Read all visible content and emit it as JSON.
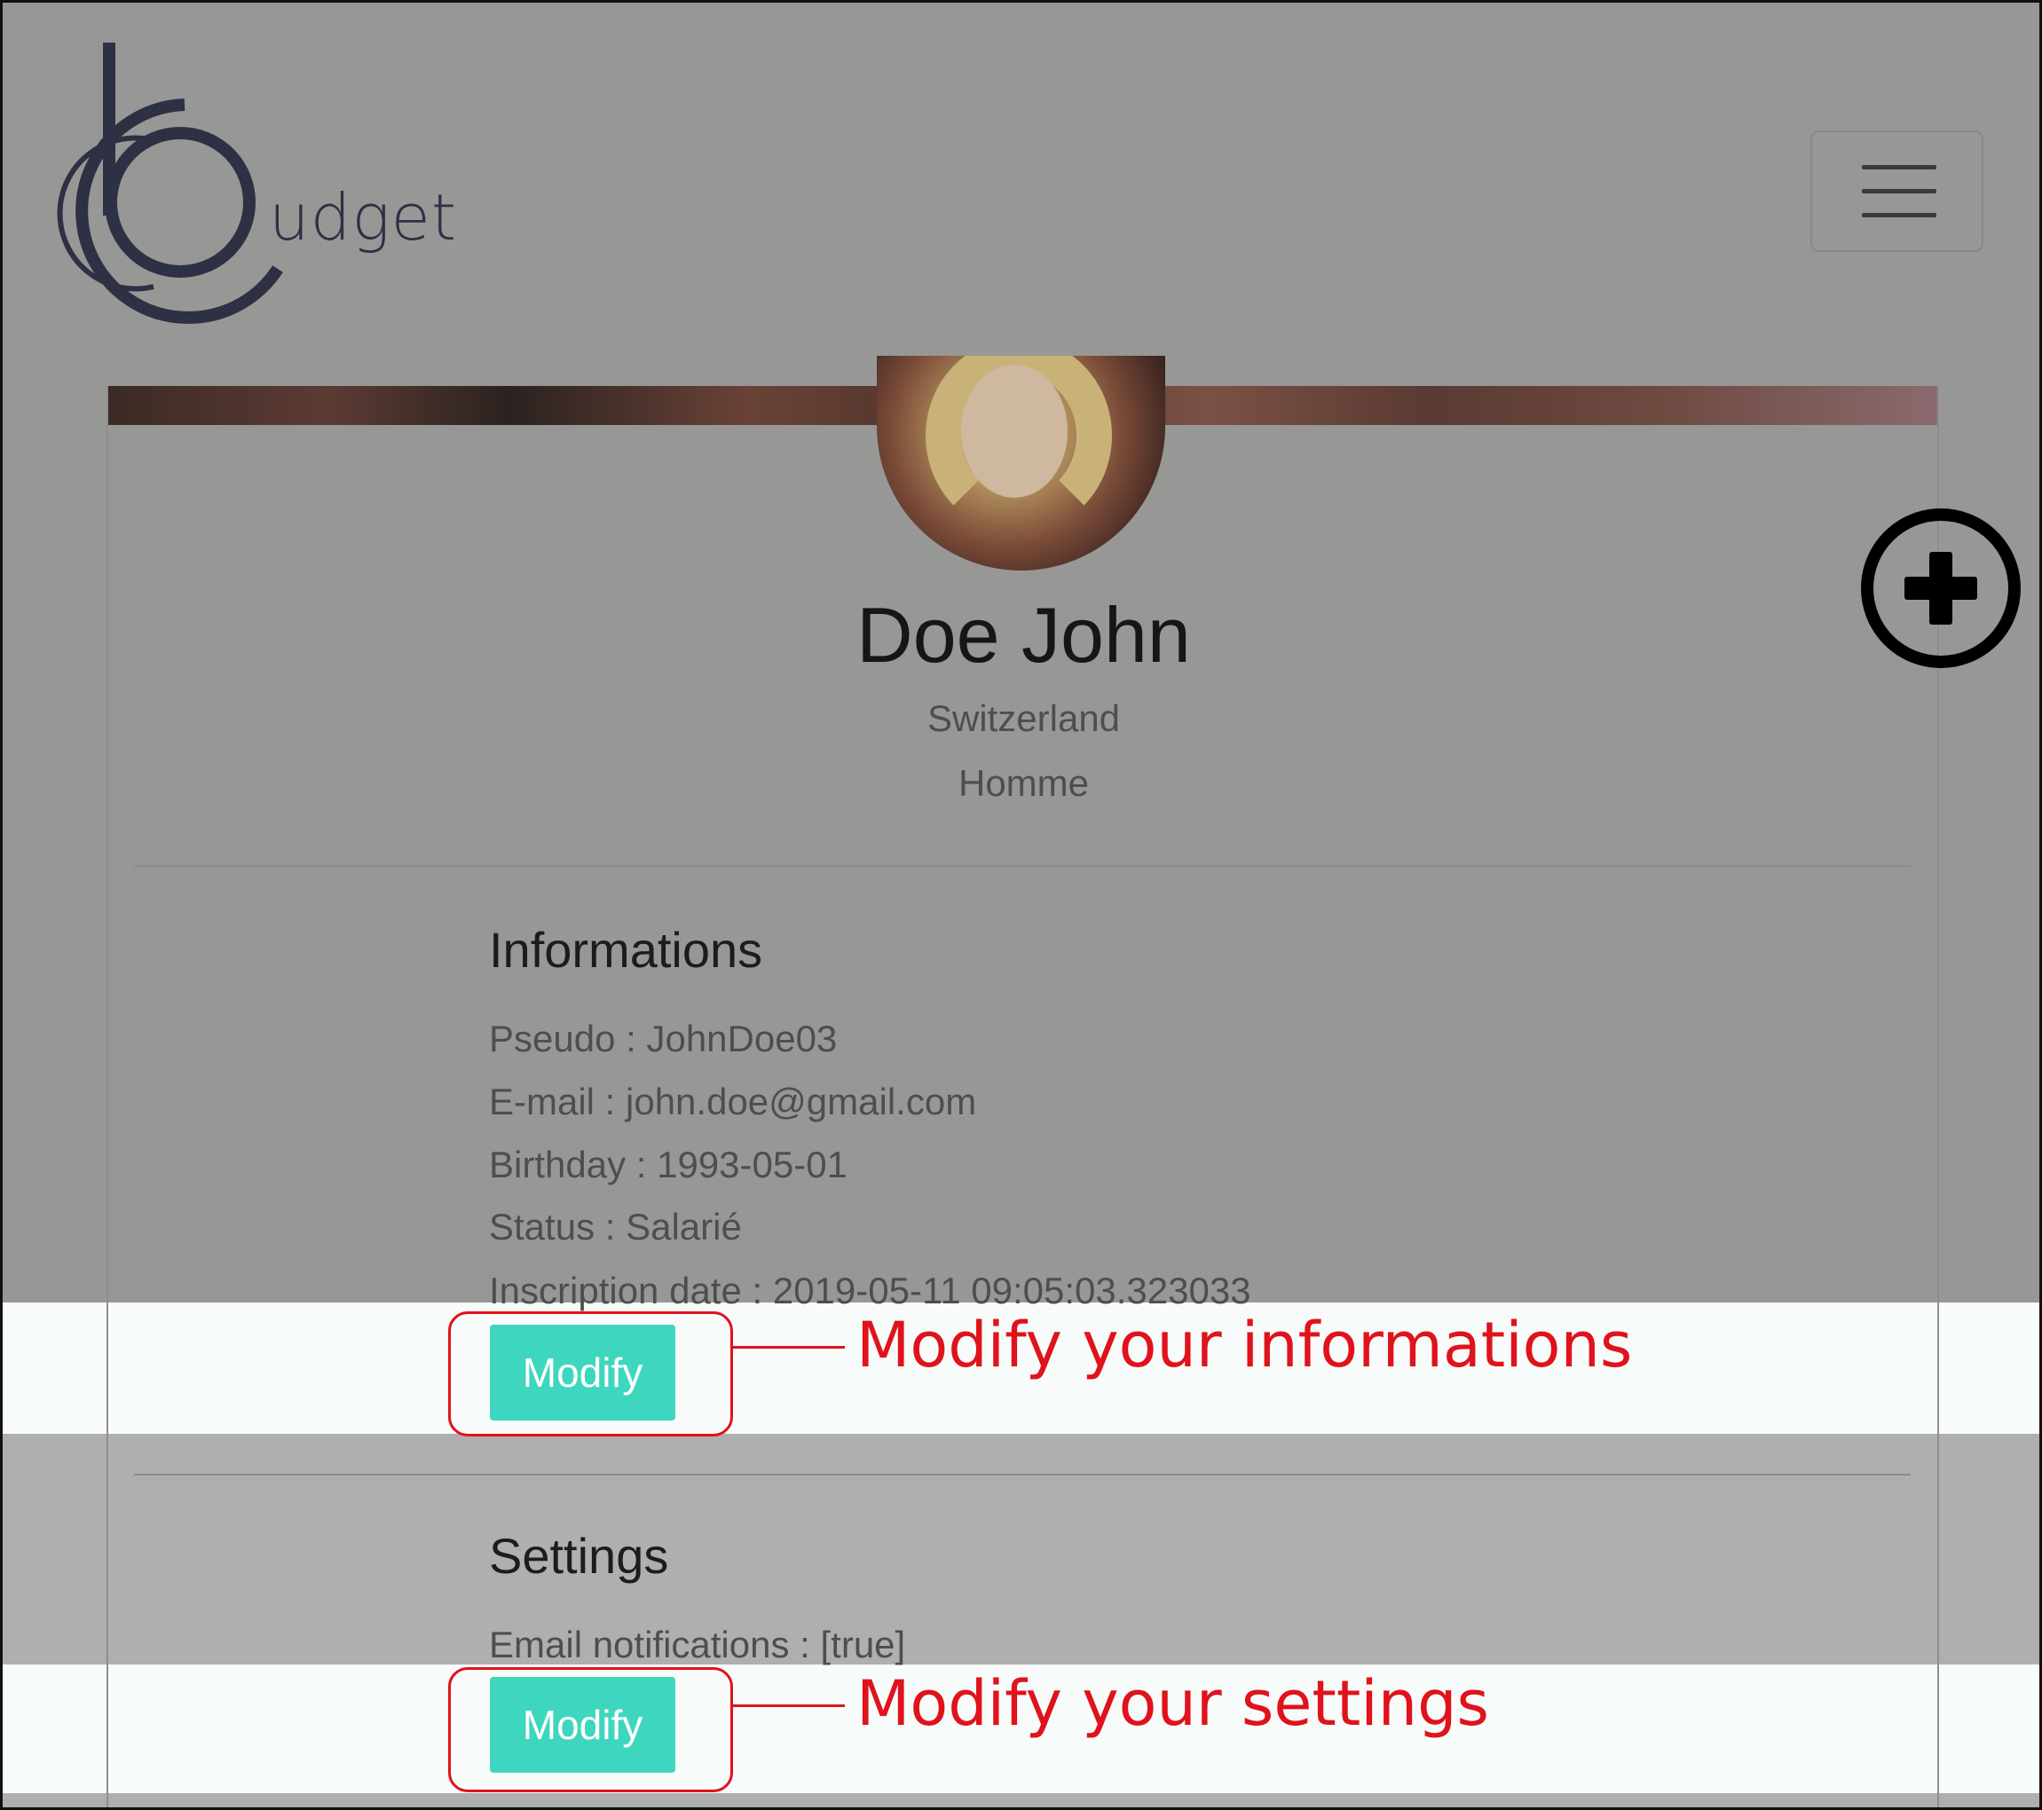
{
  "app": {
    "logo_text": "udget"
  },
  "profile": {
    "name": "Doe John",
    "country": "Switzerland",
    "gender": "Homme"
  },
  "informations": {
    "title": "Informations",
    "pseudo": "Pseudo : JohnDoe03",
    "email": "E-mail : john.doe@gmail.com",
    "birthday": "Birthday : 1993-05-01",
    "status": "Status : Salarié",
    "inscription": "Inscription date : 2019-05-11 09:05:03.323033",
    "modify_label": "Modify"
  },
  "settings": {
    "title": "Settings",
    "email_notifications": "Email notifications : [true]",
    "modify_label": "Modify"
  },
  "annotations": {
    "info": "Modify your informations",
    "settings": "Modify your settings"
  },
  "colors": {
    "accent": "#3fd6bf",
    "annotation": "#e0121c",
    "logo": "#2e3044"
  },
  "icons": {
    "menu": "hamburger-icon",
    "add": "plus-circle-icon"
  }
}
